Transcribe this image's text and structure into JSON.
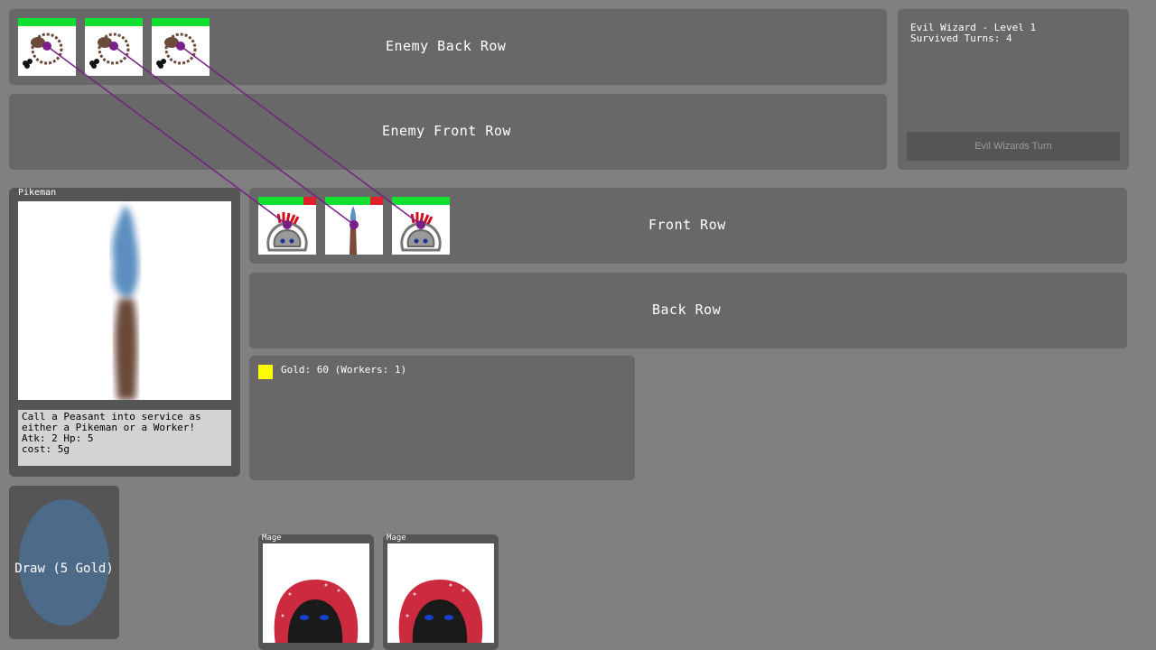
{
  "board": {
    "enemy_back_row_label": "Enemy Back Row",
    "enemy_front_row_label": "Enemy Front Row",
    "front_row_label": "Front Row",
    "back_row_label": "Back Row"
  },
  "enemy_back_units": [
    {
      "name": "wormhole",
      "hp_fraction": 1.0
    },
    {
      "name": "wormhole",
      "hp_fraction": 1.0
    },
    {
      "name": "wormhole",
      "hp_fraction": 1.0
    }
  ],
  "player_front_units": [
    {
      "name": "mage",
      "hp_fraction": 0.78
    },
    {
      "name": "pikeman",
      "hp_fraction": 0.78
    },
    {
      "name": "mage",
      "hp_fraction": 1.0
    }
  ],
  "info": {
    "enemy_name": "Evil Wizard - Level 1",
    "survived_turns": "Survived Turns: 4",
    "turn_button": "Evil Wizards Turn"
  },
  "card_detail": {
    "title": "Pikeman",
    "description_lines": [
      "Call a Peasant into service as",
      "either a Pikeman or a Worker!",
      "Atk: 2 Hp: 5",
      "cost: 5g"
    ]
  },
  "gold": {
    "text": "Gold: 60 (Workers: 1)"
  },
  "draw": {
    "label": "Draw (5 Gold)"
  },
  "hand": [
    {
      "title": "Mage"
    },
    {
      "title": "Mage"
    }
  ],
  "colors": {
    "background": "#808080",
    "panel": "#686868",
    "dark_panel": "#555555",
    "hp_full": "#10e030",
    "hp_lost": "#e0202a",
    "gold": "#ffff00",
    "attack_line": "#7a1e8a",
    "draw_button": "#4d6a89"
  }
}
